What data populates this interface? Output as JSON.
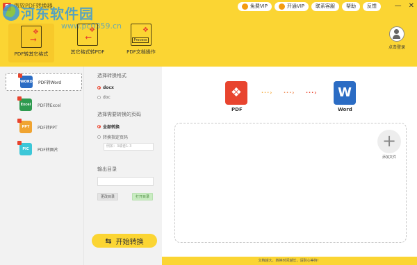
{
  "app": {
    "title": "傲软PDF转换器",
    "logo": "P"
  },
  "watermark": {
    "text": "河东软件园",
    "url": "www.pc0359.cn"
  },
  "header_buttons": {
    "free_vip": "免费VIP",
    "open_vip": "开通VIP",
    "support": "联系客服",
    "help": "帮助",
    "feedback": "反馈"
  },
  "toolbar": {
    "tools": [
      {
        "label": "PDF转其它格式"
      },
      {
        "label": "其它格式转PDF"
      },
      {
        "label": "PDF文档操作",
        "icon_text": "Process"
      }
    ]
  },
  "login": {
    "label": "点击登录"
  },
  "sidebar": {
    "items": [
      {
        "label": "PDF转Word",
        "icon": "WORD",
        "color": "#2b6cc4"
      },
      {
        "label": "PDF转Excel",
        "icon": "Excel",
        "color": "#2e9a4f"
      },
      {
        "label": "PDF转PPT",
        "icon": "PPT",
        "color": "#f0a431"
      },
      {
        "label": "PDF转图片",
        "icon": "PIC",
        "color": "#3cc7d8"
      }
    ]
  },
  "options": {
    "format_title": "选择转换格式",
    "format_options": [
      "docx",
      "doc"
    ],
    "page_title": "选择需要转换的页码",
    "page_options": [
      "全部转换",
      "转换指定页码"
    ],
    "page_placeholder": "例如：3或者1-3",
    "output_title": "输出目录",
    "change_dir": "更改目录",
    "open_folder": "打开目录",
    "start": "开始转换"
  },
  "content": {
    "from_label": "PDF",
    "to_label": "Word",
    "to_icon": "W",
    "add_label": "添加文件"
  },
  "footer": {
    "text": "文档越大，转换时间越长，请耐心等待！"
  }
}
